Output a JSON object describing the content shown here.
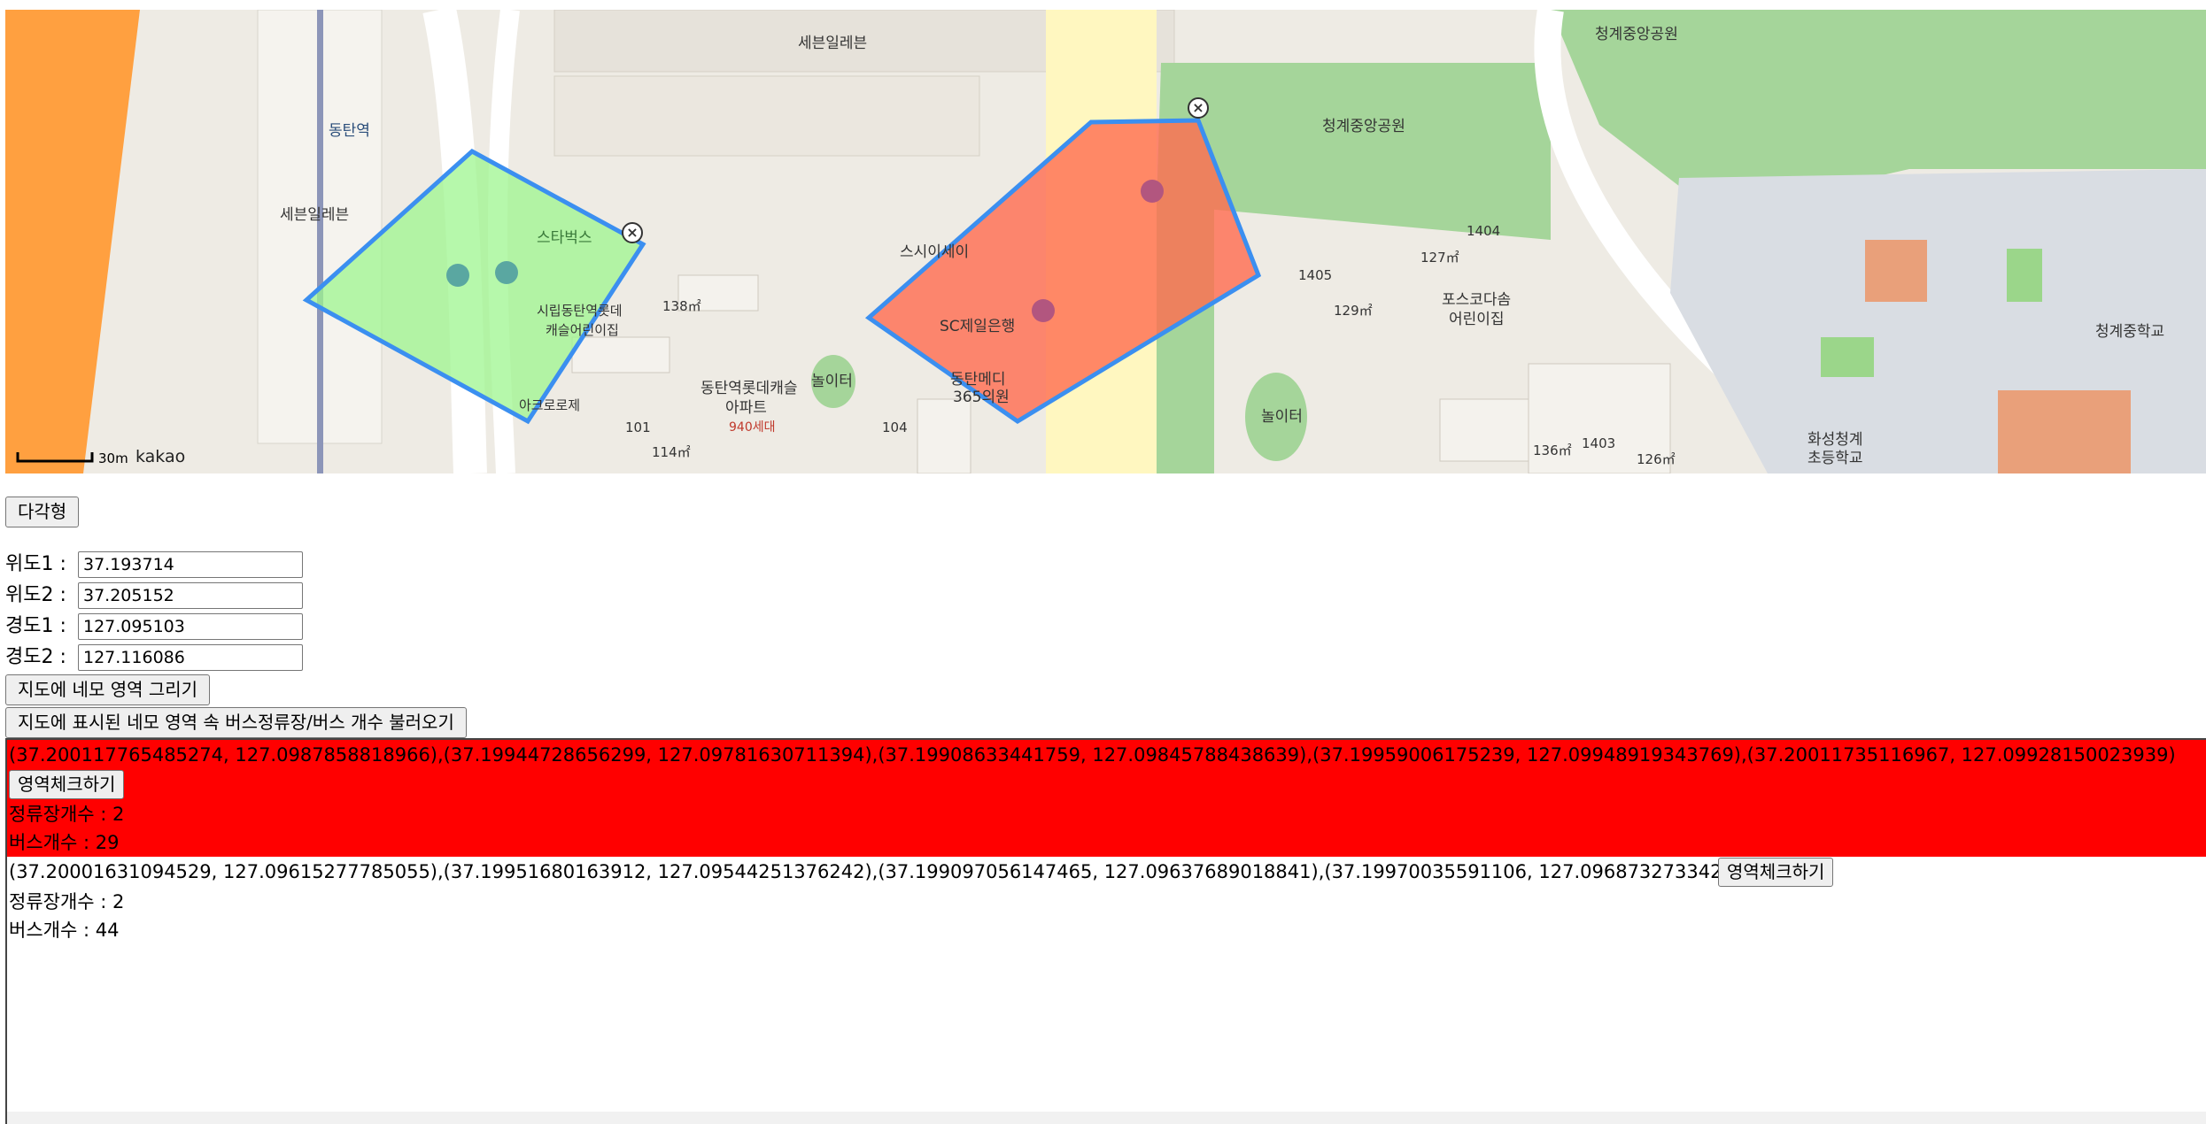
{
  "map": {
    "labels": {
      "seven_eleven_top": "세븐일레븐",
      "seven_eleven_left": "세븐일레븐",
      "dongtan_station": "동탄역",
      "starbucks": "스타벅스",
      "lotte_daycare_1": "시립동탄역롯데",
      "lotte_daycare_2": "캐슬어린이집",
      "aprogreeze": "아크로로제",
      "lotte_castle_1": "동탄역롯데캐슬",
      "lotte_castle_2": "아파트",
      "households": "940세대",
      "playground_1": "놀이터",
      "sc_bank": "SC제일은행",
      "medi_1": "동탄메디",
      "medi_2": "365의원",
      "cheonggye_park_1": "청계중앙공원",
      "cheonggye_park_2": "청계중앙공원",
      "posco_1": "포스코다솜",
      "posco_2": "어린이집",
      "playground_2": "놀이터",
      "hwaseong_school_1": "화성청계",
      "hwaseong_school_2": "초등학교",
      "cheonggye_middle": "청계중학교",
      "ssisei": "스시이세이",
      "bldg_1405": "1405",
      "bldg_1404": "1404",
      "bldg_1403": "1403",
      "bldg_101": "101",
      "bldg_104": "104",
      "area_114": "114㎡",
      "area_138": "138㎡",
      "area_127": "127㎡",
      "area_136": "136㎡",
      "area_126": "126㎡",
      "area_129": "129㎡"
    },
    "scale_text": "30m",
    "brand": "kakao",
    "colors": {
      "polygon_green": "#9ef58f",
      "polygon_red": "#ff6b4f",
      "polygon_stroke": "#3b8ff0",
      "park": "#a5d59a",
      "orange_road": "#ffa040",
      "yellow_road": "#fff7c0"
    }
  },
  "controls": {
    "polygon_button": "다각형",
    "lat1_label": "위도1 :",
    "lat1_value": "37.193714",
    "lat2_label": "위도2 :",
    "lat2_value": "37.205152",
    "lng1_label": "경도1 :",
    "lng1_value": "127.095103",
    "lng2_label": "경도2 :",
    "lng2_value": "127.116086",
    "draw_rect_button": "지도에 네모 영역 그리기",
    "load_button": "지도에 표시된 네모 영역 속 버스정류장/버스 개수 불러오기"
  },
  "results": [
    {
      "coords": "(37.200117765485274, 127.0987858818966),(37.19944728656299, 127.09781630711394),(37.19908633441759, 127.09845788438639),(37.19959006175239, 127.09948919343769),(37.20011735116967, 127.09928150023939)",
      "check_button": "영역체크하기",
      "stop_count": "정류장개수 : 2",
      "bus_count": "버스개수 : 29",
      "highlight": "#ff0000"
    },
    {
      "coords": "(37.200016310945​29, 127.09615277785055),(37.19951680163912, 127.09544251376242),(37.199097056147465, 127.09637689018841),(37.19970035591106, 127.09687327334223)",
      "check_button": "영역체크하기",
      "stop_count": "정류장개수 : 2",
      "bus_count": "버스개수 : 44"
    }
  ]
}
